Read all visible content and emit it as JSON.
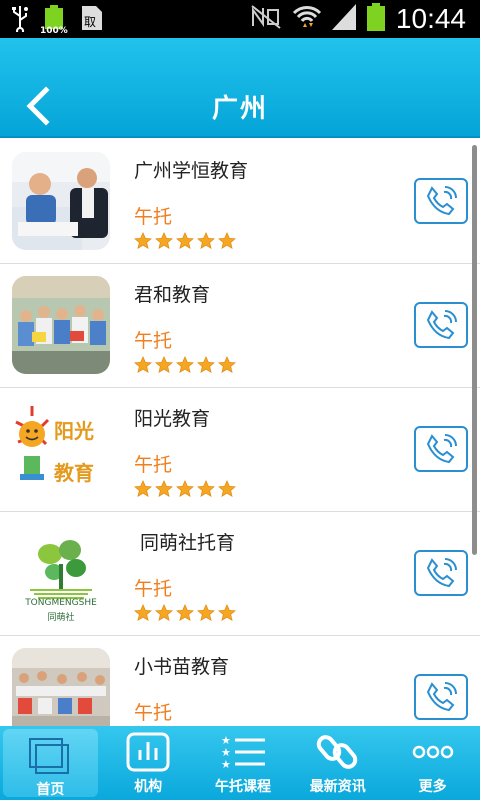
{
  "status_bar": {
    "time": "10:44",
    "battery_left": "100%"
  },
  "header": {
    "title": "广州"
  },
  "list": [
    {
      "name": "广州学恒教育",
      "tag": "午托",
      "rating": 5
    },
    {
      "name": "君和教育",
      "tag": "午托",
      "rating": 5
    },
    {
      "name": "阳光教育",
      "tag": "午托",
      "rating": 5,
      "logo_text": "阳光 教育"
    },
    {
      "name": " 同萌社托育",
      "tag": "午托",
      "rating": 5,
      "logo_text": "TONGMENGSHE",
      "logo_cn": "同萌社"
    },
    {
      "name": "小书苗教育",
      "tag": "午托",
      "rating": 5
    }
  ],
  "tabs": [
    {
      "label": "首页",
      "icon": "home-icon"
    },
    {
      "label": "机构",
      "icon": "chart-icon"
    },
    {
      "label": "午托课程",
      "icon": "list-icon"
    },
    {
      "label": "最新资讯",
      "icon": "link-icon"
    },
    {
      "label": "更多",
      "icon": "more-icon"
    }
  ],
  "colors": {
    "accent": "#0aa8dc",
    "tag": "#f07e1c",
    "star": "#f5a623",
    "phone_border": "#2a8fd0"
  }
}
